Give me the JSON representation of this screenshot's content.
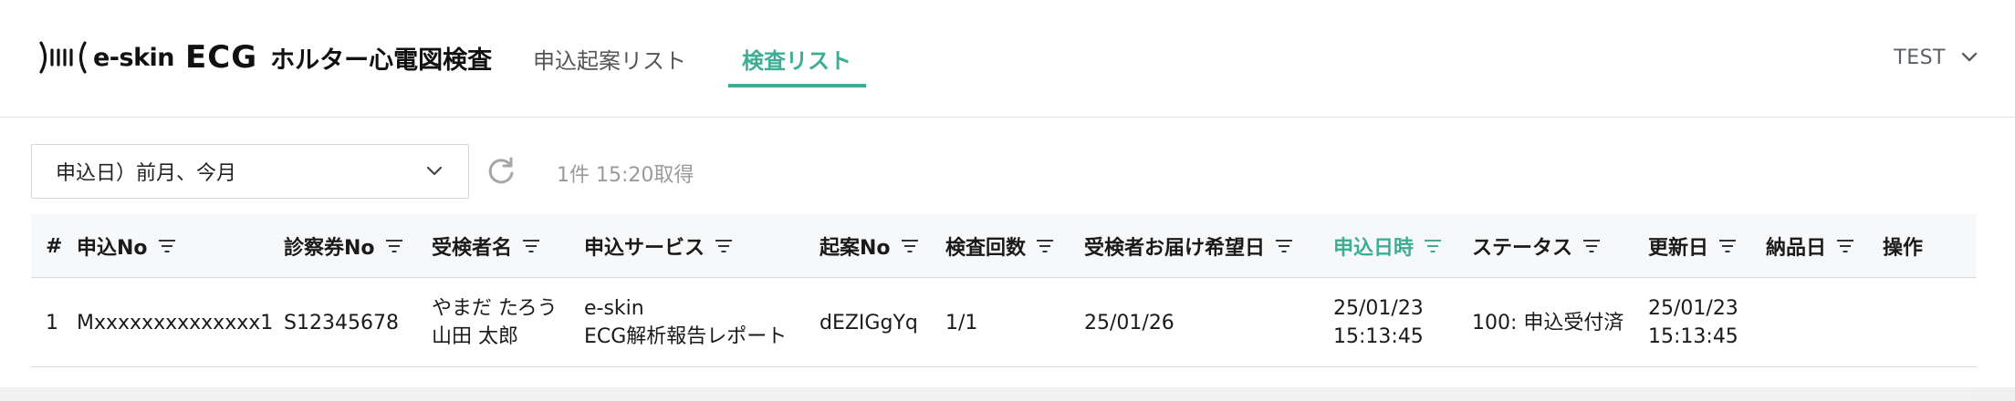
{
  "brand": {
    "logo_text": "e-skin",
    "product": "ECG",
    "title": "ホルター心電図検査"
  },
  "nav": {
    "tabs": [
      {
        "label": "申込起案リスト",
        "active": false
      },
      {
        "label": "検査リスト",
        "active": true
      }
    ]
  },
  "user": {
    "name": "TEST"
  },
  "filter": {
    "period_value": "申込日）前月、今月",
    "status": "1件 15:20取得"
  },
  "colors": {
    "accent": "#3dae94",
    "header_bg": "#f7f8f9"
  },
  "table": {
    "columns": [
      {
        "label": "#",
        "sortable": false
      },
      {
        "label": "申込No",
        "sortable": true
      },
      {
        "label": "診察券No",
        "sortable": true
      },
      {
        "label": "受検者名",
        "sortable": true
      },
      {
        "label": "申込サービス",
        "sortable": true
      },
      {
        "label": "起案No",
        "sortable": true
      },
      {
        "label": "検査回数",
        "sortable": true
      },
      {
        "label": "受検者お届け希望日",
        "sortable": true
      },
      {
        "label": "申込日時",
        "sortable": true,
        "active": true
      },
      {
        "label": "ステータス",
        "sortable": true
      },
      {
        "label": "更新日",
        "sortable": true
      },
      {
        "label": "納品日",
        "sortable": true
      },
      {
        "label": "操作",
        "sortable": false
      }
    ],
    "rows": [
      {
        "index": "1",
        "application_no": "Mxxxxxxxxxxxxxx1",
        "patient_card_no": "S12345678",
        "name_kana": "やまだ たろう",
        "name_kanji": "山田 太郎",
        "service_line1": "e-skin",
        "service_line2": "ECG解析報告レポート",
        "draft_no": "dEZIGgYq",
        "exam_count": "1/1",
        "delivery_date": "25/01/26",
        "applied_date": "25/01/23",
        "applied_time": "15:13:45",
        "status": "100: 申込受付済",
        "updated_date": "25/01/23",
        "updated_time": "15:13:45",
        "delivered_date": "",
        "actions": ""
      }
    ]
  }
}
